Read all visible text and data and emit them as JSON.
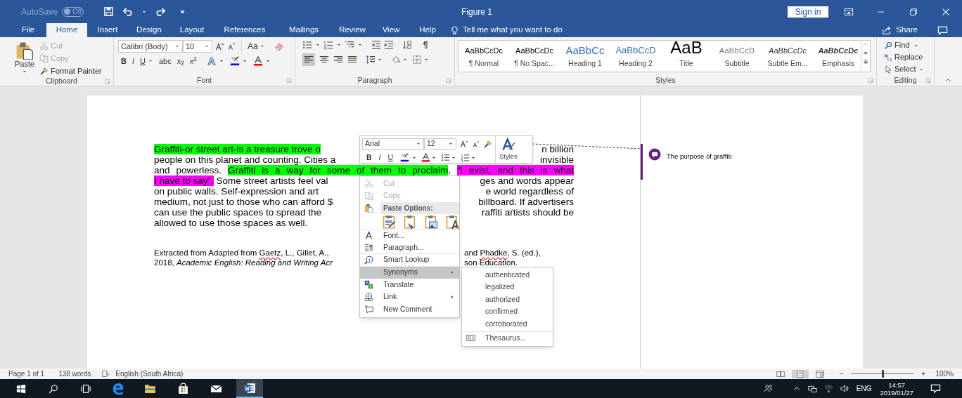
{
  "title_bar": {
    "autosave_label": "AutoSave",
    "autosave_toggle": {
      "label": "Off",
      "on": false
    },
    "document_title": "Figure 1",
    "sign_in": "Sign in"
  },
  "tabs": [
    {
      "label": "File",
      "selected": false
    },
    {
      "label": "Home",
      "selected": true
    },
    {
      "label": "Insert",
      "selected": false
    },
    {
      "label": "Design",
      "selected": false
    },
    {
      "label": "Layout",
      "selected": false
    },
    {
      "label": "References",
      "selected": false
    },
    {
      "label": "Mailings",
      "selected": false
    },
    {
      "label": "Review",
      "selected": false
    },
    {
      "label": "View",
      "selected": false
    },
    {
      "label": "Help",
      "selected": false
    }
  ],
  "tell_me": {
    "placeholder": "Tell me what you want to do"
  },
  "share": "Share",
  "ribbon": {
    "clipboard": {
      "label": "Clipboard",
      "paste": "Paste",
      "cut": {
        "label": "Cut",
        "disabled": true
      },
      "copy": {
        "label": "Copy",
        "disabled": true
      },
      "format_painter": {
        "label": "Format Painter",
        "disabled": false
      }
    },
    "font": {
      "label": "Font",
      "font_name": "Calibri (Body)",
      "font_size": "10",
      "change_case": "Aa",
      "buttons": [
        "B",
        "I",
        "U",
        "abc",
        "x$_{2}$",
        "x$^{2}$"
      ]
    },
    "paragraph": {
      "label": "Paragraph"
    },
    "styles": {
      "label": "Styles",
      "items": [
        {
          "kind": "normal",
          "preview": "AaBbCcDc",
          "label": "¶ Normal"
        },
        {
          "kind": "normal",
          "preview": "AaBbCcDc",
          "label": "¶ No Spac..."
        },
        {
          "kind": "heading1",
          "preview": "AaBbCc",
          "label": "Heading 1"
        },
        {
          "kind": "heading2",
          "preview": "AaBbCcD",
          "label": "Heading 2"
        },
        {
          "kind": "title",
          "preview": "AaB",
          "label": "Title"
        },
        {
          "kind": "subtitle",
          "preview": "AaBbCcD",
          "label": "Subtitle"
        },
        {
          "kind": "emphasis",
          "preview": "AaBbCcDc",
          "label": "Subtle Em..."
        },
        {
          "kind": "emphasis",
          "preview": "AaBbCcDc",
          "label": "Emphasis"
        }
      ]
    },
    "editing": {
      "label": "Editing",
      "find": "Find",
      "replace": "Replace",
      "select": "Select"
    }
  },
  "document": {
    "paragraph": [
      {
        "left": [
          {
            "text": "Graffiti-or street art-is a treasure trove o",
            "color": "#00ff00"
          }
        ],
        "right": [
          {
            "text": "n billion"
          }
        ]
      },
      {
        "left": [
          {
            "text": "people on this planet and counting. Cities a"
          }
        ],
        "right": [
          {
            "text": "invisible"
          }
        ]
      },
      {
        "left": [
          {
            "text": "and powerless. "
          },
          {
            "text": "Graffiti is a way for some of them to proclaim",
            "color": "#00ff00"
          },
          {
            "text": ", "
          },
          {
            "text": "“I exist, and this is what",
            "color": "#ff00ff"
          }
        ]
      },
      {
        "left": [
          {
            "text": "I have to say”.",
            "color": "#ff00ff"
          },
          {
            "text": " Some street artists feel val"
          }
        ],
        "right": [
          {
            "text": "ges and words appear"
          }
        ]
      },
      {
        "left": [
          {
            "text": "on public walls. Self-expression and art"
          }
        ],
        "right": [
          {
            "text": "e world regardless of"
          }
        ]
      },
      {
        "left": [
          {
            "text": "medium, not just to those who can afford $"
          }
        ],
        "right": [
          {
            "text": "billboard. If advertisers"
          }
        ]
      },
      {
        "left": [
          {
            "text": "can use the public spaces to spread the"
          }
        ],
        "right": [
          {
            "text": "raffiti artists should be"
          }
        ]
      },
      {
        "left": [
          {
            "text": "allowed to use those spaces as well."
          }
        ]
      }
    ],
    "citation": [
      {
        "left": [
          {
            "text": "Extracted from Adapted from "
          },
          {
            "text": "Gaetz",
            "misspelled": true
          },
          {
            "text": ", L., Gillet, A.,"
          }
        ],
        "right": [
          {
            "text": "and "
          },
          {
            "text": "Phadke",
            "misspelled": true
          },
          {
            "text": ", S. (ed.),"
          }
        ]
      },
      {
        "left": [
          {
            "text": "2018, "
          },
          {
            "text": "Academic English: Reading and Writing Acr",
            "italic": true
          }
        ],
        "right": [
          {
            "text": "son Education."
          }
        ]
      }
    ],
    "comment": "The purpose of graffiti"
  },
  "mini_toolbar": {
    "font": "Arial",
    "size": "12",
    "buttons": [
      "B",
      "I",
      "U"
    ],
    "styles_label": "Styles"
  },
  "context_menu": {
    "items": [
      {
        "kind": "item",
        "label": "Cut",
        "disabled": true
      },
      {
        "kind": "item",
        "label": "Copy",
        "disabled": true
      },
      {
        "kind": "header",
        "label": "Paste Options:"
      },
      {
        "kind": "paste_icons"
      },
      {
        "kind": "item",
        "label": "Font...",
        "disabled": false
      },
      {
        "kind": "item",
        "label": "Paragraph...",
        "disabled": false
      },
      {
        "kind": "item",
        "label": "Smart Lookup",
        "disabled": false
      },
      {
        "kind": "submenu",
        "label": "Synonyms",
        "selected": true
      },
      {
        "kind": "item",
        "label": "Translate",
        "disabled": false
      },
      {
        "kind": "submenu",
        "label": "Link",
        "selected": false
      },
      {
        "kind": "item",
        "label": "New Comment",
        "disabled": false
      }
    ]
  },
  "synonyms_menu": {
    "words": [
      "authenticated",
      "legalized",
      "authorized",
      "confirmed",
      "corroborated"
    ],
    "thesaurus": "Thesaurus..."
  },
  "status_bar": {
    "page": "Page 1 of 1",
    "words": "138 words",
    "language": "English (South Africa)",
    "zoom_out": "−",
    "zoom_in": "+",
    "zoom": {
      "level": 0.5
    },
    "zoom_percent": "100%"
  },
  "taskbar": {
    "language": "ENG",
    "time": "14:57",
    "date": "2019/01/27"
  }
}
